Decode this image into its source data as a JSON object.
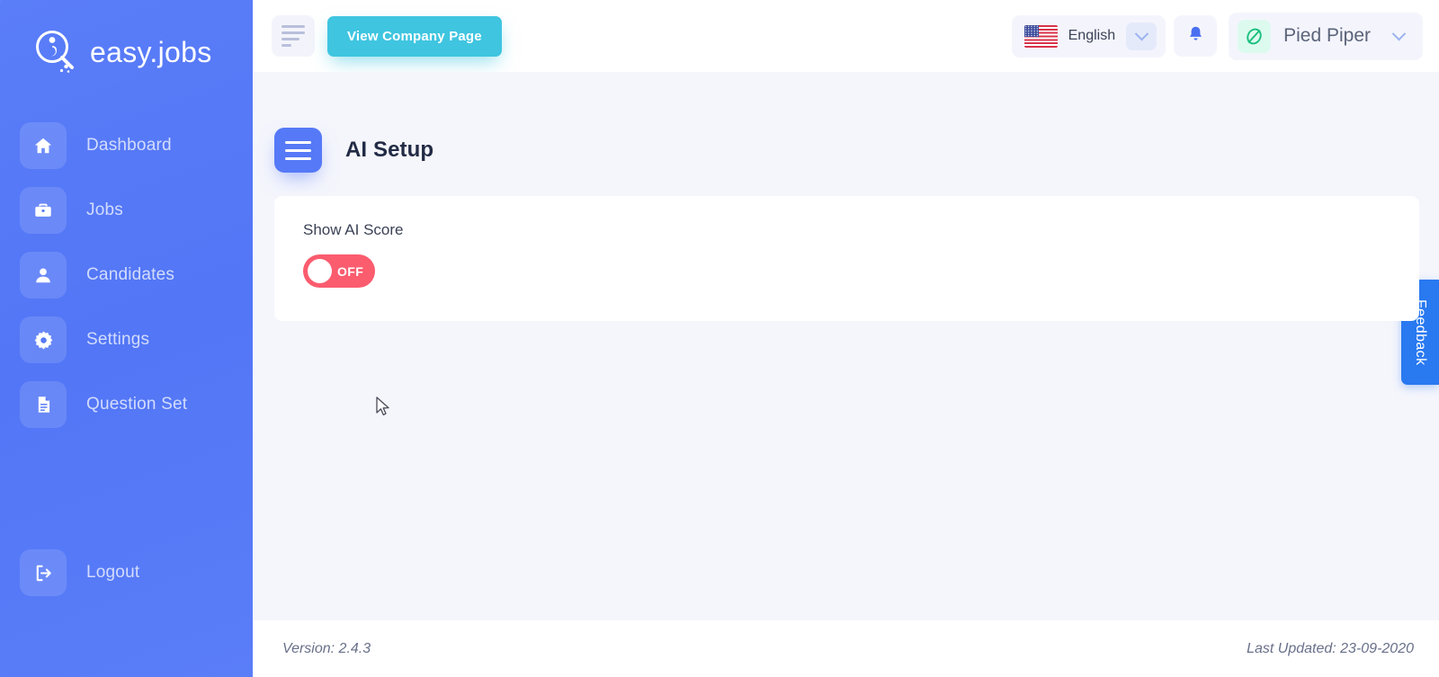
{
  "brand": {
    "name": "easy.jobs",
    "logo_icon": "magnifier-person-logo"
  },
  "sidebar": {
    "items": [
      {
        "label": "Dashboard",
        "icon": "home-icon"
      },
      {
        "label": "Jobs",
        "icon": "briefcase-icon"
      },
      {
        "label": "Candidates",
        "icon": "user-icon"
      },
      {
        "label": "Settings",
        "icon": "gear-icon"
      },
      {
        "label": "Question Set",
        "icon": "document-list-icon"
      }
    ],
    "logout": {
      "label": "Logout",
      "icon": "logout-icon"
    },
    "bg_color": "#5679f7"
  },
  "topbar": {
    "menu_icon": "align-left-icon",
    "view_company_label": "View Company Page",
    "view_company_color": "#3fc5e0",
    "language": {
      "name": "English",
      "flag_icon": "us-flag-icon",
      "chevron_icon": "chevron-down-icon"
    },
    "notification_icon": "bell-icon",
    "user": {
      "name": "Pied Piper",
      "avatar_icon": "pied-piper-logo-icon",
      "chevron_icon": "chevron-down-icon"
    }
  },
  "main": {
    "sidebar_toggle_icon": "hamburger-icon",
    "page_title": "AI Setup",
    "card": {
      "label": "Show AI Score",
      "toggle_state": "OFF",
      "toggle_color": "#fb5c6e"
    }
  },
  "footer": {
    "version": "Version: 2.4.3",
    "last_updated": "Last Updated: 23-09-2020"
  },
  "feedback": {
    "label": "Feedback",
    "color": "#2979f0"
  }
}
